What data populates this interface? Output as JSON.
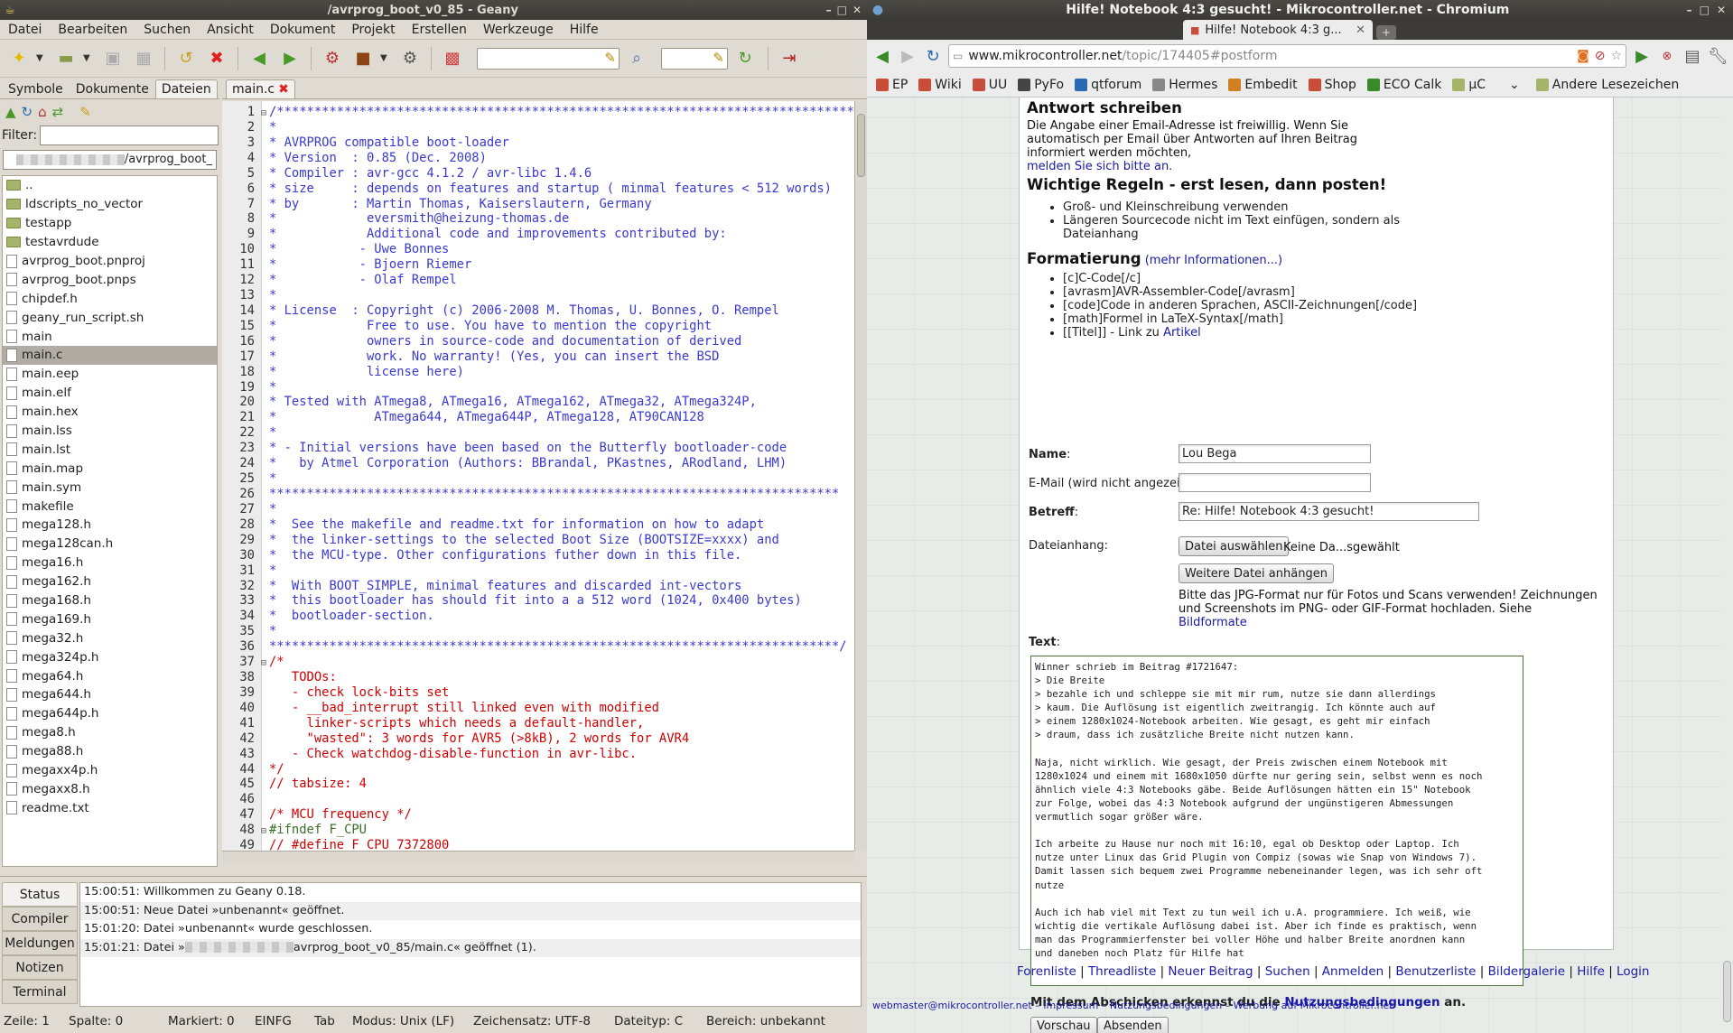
{
  "geany": {
    "title": "/avrprog_boot_v0_85 - Geany",
    "menu": [
      "Datei",
      "Bearbeiten",
      "Suchen",
      "Ansicht",
      "Dokument",
      "Projekt",
      "Erstellen",
      "Werkzeuge",
      "Hilfe"
    ],
    "sidebar_tabs": [
      "Symbole",
      "Dokumente",
      "Dateien"
    ],
    "filter_label": "Filter:",
    "filter_value": "",
    "path_value": "/avrprog_boot_",
    "files": [
      {
        "name": "..",
        "type": "folder"
      },
      {
        "name": "ldscripts_no_vector",
        "type": "folder"
      },
      {
        "name": "testapp",
        "type": "folder"
      },
      {
        "name": "testavrdude",
        "type": "folder"
      },
      {
        "name": "avrprog_boot.pnproj",
        "type": "file"
      },
      {
        "name": "avrprog_boot.pnps",
        "type": "file"
      },
      {
        "name": "chipdef.h",
        "type": "file"
      },
      {
        "name": "geany_run_script.sh",
        "type": "file"
      },
      {
        "name": "main",
        "type": "file"
      },
      {
        "name": "main.c",
        "type": "file",
        "selected": true
      },
      {
        "name": "main.eep",
        "type": "file"
      },
      {
        "name": "main.elf",
        "type": "file"
      },
      {
        "name": "main.hex",
        "type": "file"
      },
      {
        "name": "main.lss",
        "type": "file"
      },
      {
        "name": "main.lst",
        "type": "file"
      },
      {
        "name": "main.map",
        "type": "file"
      },
      {
        "name": "main.sym",
        "type": "file"
      },
      {
        "name": "makefile",
        "type": "file"
      },
      {
        "name": "mega128.h",
        "type": "file"
      },
      {
        "name": "mega128can.h",
        "type": "file"
      },
      {
        "name": "mega16.h",
        "type": "file"
      },
      {
        "name": "mega162.h",
        "type": "file"
      },
      {
        "name": "mega168.h",
        "type": "file"
      },
      {
        "name": "mega169.h",
        "type": "file"
      },
      {
        "name": "mega32.h",
        "type": "file"
      },
      {
        "name": "mega324p.h",
        "type": "file"
      },
      {
        "name": "mega64.h",
        "type": "file"
      },
      {
        "name": "mega644.h",
        "type": "file"
      },
      {
        "name": "mega644p.h",
        "type": "file"
      },
      {
        "name": "mega8.h",
        "type": "file"
      },
      {
        "name": "mega88.h",
        "type": "file"
      },
      {
        "name": "megaxx4p.h",
        "type": "file"
      },
      {
        "name": "megaxx8.h",
        "type": "file"
      },
      {
        "name": "readme.txt",
        "type": "file"
      }
    ],
    "editor_tab": "main.c",
    "code_lines": [
      {
        "n": "1",
        "t": "/*****************************************************************************",
        "c": "t",
        "fold": "−"
      },
      {
        "n": "2",
        "t": "*",
        "c": "t"
      },
      {
        "n": "3",
        "t": "* AVRPROG compatible boot-loader",
        "c": "t"
      },
      {
        "n": "4",
        "t": "* Version  : 0.85 (Dec. 2008)",
        "c": "t"
      },
      {
        "n": "5",
        "t": "* Compiler : avr-gcc 4.1.2 / avr-libc 1.4.6",
        "c": "t"
      },
      {
        "n": "6",
        "t": "* size     : depends on features and startup ( minmal features < 512 words)",
        "c": "t"
      },
      {
        "n": "7",
        "t": "* by       : Martin Thomas, Kaiserslautern, Germany",
        "c": "t"
      },
      {
        "n": "8",
        "t": "*            eversmith@heizung-thomas.de",
        "c": "t"
      },
      {
        "n": "9",
        "t": "*            Additional code and improvements contributed by:",
        "c": "t"
      },
      {
        "n": "10",
        "t": "*           - Uwe Bonnes",
        "c": "t"
      },
      {
        "n": "11",
        "t": "*           - Bjoern Riemer",
        "c": "t"
      },
      {
        "n": "12",
        "t": "*           - Olaf Rempel",
        "c": "t"
      },
      {
        "n": "13",
        "t": "*",
        "c": "t"
      },
      {
        "n": "14",
        "t": "* License  : Copyright (c) 2006-2008 M. Thomas, U. Bonnes, O. Rempel",
        "c": "t"
      },
      {
        "n": "15",
        "t": "*            Free to use. You have to mention the copyright",
        "c": "t"
      },
      {
        "n": "16",
        "t": "*            owners in source-code and documentation of derived",
        "c": "t"
      },
      {
        "n": "17",
        "t": "*            work. No warranty! (Yes, you can insert the BSD",
        "c": "t"
      },
      {
        "n": "18",
        "t": "*            license here)",
        "c": "t"
      },
      {
        "n": "19",
        "t": "*",
        "c": "t"
      },
      {
        "n": "20",
        "t": "* Tested with ATmega8, ATmega16, ATmega162, ATmega32, ATmega324P,",
        "c": "t"
      },
      {
        "n": "21",
        "t": "*             ATmega644, ATmega644P, ATmega128, AT90CAN128",
        "c": "t"
      },
      {
        "n": "22",
        "t": "*",
        "c": "t"
      },
      {
        "n": "23",
        "t": "* - Initial versions have been based on the Butterfly bootloader-code",
        "c": "t"
      },
      {
        "n": "24",
        "t": "*   by Atmel Corporation (Authors: BBrandal, PKastnes, ARodland, LHM)",
        "c": "t"
      },
      {
        "n": "25",
        "t": "*",
        "c": "t"
      },
      {
        "n": "26",
        "t": "****************************************************************************",
        "c": "t"
      },
      {
        "n": "27",
        "t": "*",
        "c": "t"
      },
      {
        "n": "28",
        "t": "*  See the makefile and readme.txt for information on how to adapt",
        "c": "t"
      },
      {
        "n": "29",
        "t": "*  the linker-settings to the selected Boot Size (BOOTSIZE=xxxx) and",
        "c": "t"
      },
      {
        "n": "30",
        "t": "*  the MCU-type. Other configurations futher down in this file.",
        "c": "t"
      },
      {
        "n": "31",
        "t": "*",
        "c": "t"
      },
      {
        "n": "32",
        "t": "*  With BOOT_SIMPLE, minimal features and discarded int-vectors",
        "c": "t"
      },
      {
        "n": "33",
        "t": "*  this bootloader has should fit into a a 512 word (1024, 0x400 bytes)",
        "c": "t"
      },
      {
        "n": "34",
        "t": "*  bootloader-section.",
        "c": "t"
      },
      {
        "n": "35",
        "t": "*",
        "c": "t"
      },
      {
        "n": "36",
        "t": "****************************************************************************/",
        "c": "t"
      },
      {
        "n": "37",
        "t": "/*",
        "c": "t red",
        "fold": "−"
      },
      {
        "n": "38",
        "t": "   TODOs:",
        "c": "t red"
      },
      {
        "n": "39",
        "t": "   - check lock-bits set",
        "c": "t red"
      },
      {
        "n": "40",
        "t": "   - __bad_interrupt still linked even with modified",
        "c": "t red"
      },
      {
        "n": "41",
        "t": "     linker-scripts which needs a default-handler,",
        "c": "t red"
      },
      {
        "n": "42",
        "t": "     \"wasted\": 3 words for AVR5 (>8kB), 2 words for AVR4",
        "c": "t red"
      },
      {
        "n": "43",
        "t": "   - Check watchdog-disable-function in avr-libc.",
        "c": "t red"
      },
      {
        "n": "44",
        "t": "*/",
        "c": "t red"
      },
      {
        "n": "45",
        "t": "// tabsize: 4",
        "c": "t red"
      },
      {
        "n": "46",
        "t": "",
        "c": "t"
      },
      {
        "n": "47",
        "t": "/* MCU frequency */",
        "c": "t red"
      },
      {
        "n": "48",
        "t": "#ifndef F_CPU",
        "c": "t pre",
        "fold": "−"
      },
      {
        "n": "49",
        "t": "// #define F_CPU 7372800",
        "c": "t red"
      }
    ],
    "msg_tabs": [
      "Status",
      "Compiler",
      "Meldungen",
      "Notizen",
      "Terminal"
    ],
    "messages": [
      "15:00:51: Willkommen zu Geany 0.18.",
      "15:00:51: Neue Datei »unbenannt« geöffnet.",
      "15:01:20: Datei »unbenannt« wurde geschlossen.",
      "15:01:21: Datei »"
    ],
    "msg_last_tail": "avrprog_boot_v0_85/main.c« geöffnet (1).",
    "status": {
      "zeile": "Zeile: 1",
      "spalte": "Spalte: 0",
      "markiert": "Markiert: 0",
      "mode": "EINFG",
      "tab": "Tab",
      "modus": "Modus: Unix (LF)",
      "zeichensatz": "Zeichensatz: UTF-8",
      "dateityp": "Dateityp: C",
      "bereich": "Bereich: unbekannt"
    }
  },
  "chrome": {
    "title": "Hilfe! Notebook 4:3 gesucht! - Mikrocontroller.net - Chromium",
    "tab_title": "Hilfe! Notebook 4:3 g...",
    "url_host": "www.mikrocontroller.net",
    "url_rest": "/topic/174405#postform",
    "bookmarks": [
      "EP",
      "Wiki",
      "UU",
      "PyFo",
      "qtforum",
      "Hermes",
      "Embedit",
      "Shop",
      "ECO Calk",
      "µC"
    ],
    "bookmarks_other": "Andere Lesezeichen",
    "answer_title": "Antwort schreiben",
    "answer_text": "Die Angabe einer Email-Adresse ist freiwillig. Wenn Sie automatisch per Email über Antworten auf Ihren Beitrag informiert werden möchten,",
    "answer_link": "melden Sie sich bitte an.",
    "rules_title": "Wichtige Regeln - erst lesen, dann posten!",
    "rules": [
      "Groß- und Kleinschreibung verwenden",
      "Längeren Sourcecode nicht im Text einfügen, sondern als Dateianhang"
    ],
    "format_title": "Formatierung",
    "format_link": "(mehr Informationen...)",
    "formats": [
      "[c]C-Code[/c]",
      "[avrasm]AVR-Assembler-Code[/avrasm]",
      "[code]Code in anderen Sprachen, ASCII-Zeichnungen[/code]",
      "[math]Formel in LaTeX-Syntax[/math]",
      "[[Titel]] - Link zu "
    ],
    "format_last_link": "Artikel",
    "name_label": "Name",
    "name_value": "Lou Bega",
    "email_label": "E-Mail (wird nicht angezeigt):",
    "email_value": "",
    "subject_label": "Betreff",
    "subject_value": "Re: Hilfe! Notebook 4:3 gesucht!",
    "attach_label": "Dateianhang:",
    "choose_file": "Datei auswählen",
    "no_file": "Keine Da...sgewählt",
    "more_file": "Weitere Datei anhängen",
    "attach_hint": "Bitte das JPG-Format nur für Fotos und Scans verwenden! Zeichnungen und Screenshots im PNG- oder GIF-Format hochladen. Siehe ",
    "attach_hint_link": "Bildformate",
    "text_label": "Text",
    "textarea": "Winner schrieb im Beitrag #1721647:\n> Die Breite\n> bezahle ich und schleppe sie mit mir rum, nutze sie dann allerdings\n> kaum. Die Auflösung ist eigentlich zweitrangig. Ich könnte auch auf\n> einem 1280x1024-Notebook arbeiten. Wie gesagt, es geht mir einfach\n> draum, dass ich zusätzliche Breite nicht nutzen kann.\n\nNaja, nicht wirklich. Wie gesagt, der Preis zwischen einem Notebook mit\n1280x1024 und einem mit 1680x1050 dürfte nur gering sein, selbst wenn es noch\nähnlich viele 4:3 Notebooks gäbe. Beide Auflösungen hätten ein 15\" Notebook\nzur Folge, wobei das 4:3 Notebook aufgrund der ungünstigeren Abmessungen\nvermutlich sogar größer wäre.\n\nIch arbeite zu Hause nur noch mit 16:10, egal ob Desktop oder Laptop. Ich\nnutze unter Linux das Grid Plugin von Compiz (sowas wie Snap von Windows 7).\nDamit lassen sich bequem zwei Programme nebeneinander legen, was ich sehr oft\nnutze\n\nAuch ich hab viel mit Text zu tun weil ich u.A. programmiere. Ich weiß, wie\nwichtig die vertikale Auflösung dabei ist. Aber ich finde es praktisch, wenn\nman das Programmierfenster bei voller Höhe und halber Breite anordnen kann\nund daneben noch Platz für Hilfe hat",
    "terms_text": "Mit dem Abschicken erkennst du die ",
    "terms_link": "Nutzungsbedingungen",
    "terms_after": " an.",
    "preview_btn": "Vorschau",
    "submit_btn": "Absenden",
    "footer_links": [
      "Forenliste",
      "Threadliste",
      "Neuer Beitrag",
      "Suchen",
      "Anmelden",
      "Benutzerliste",
      "Bildergalerie",
      "Hilfe",
      "Login"
    ],
    "webmaster": "webmaster@mikrocontroller.net – Impressum – Nutzungsbedingungen – Werbung auf Mikrocontroller.net"
  }
}
